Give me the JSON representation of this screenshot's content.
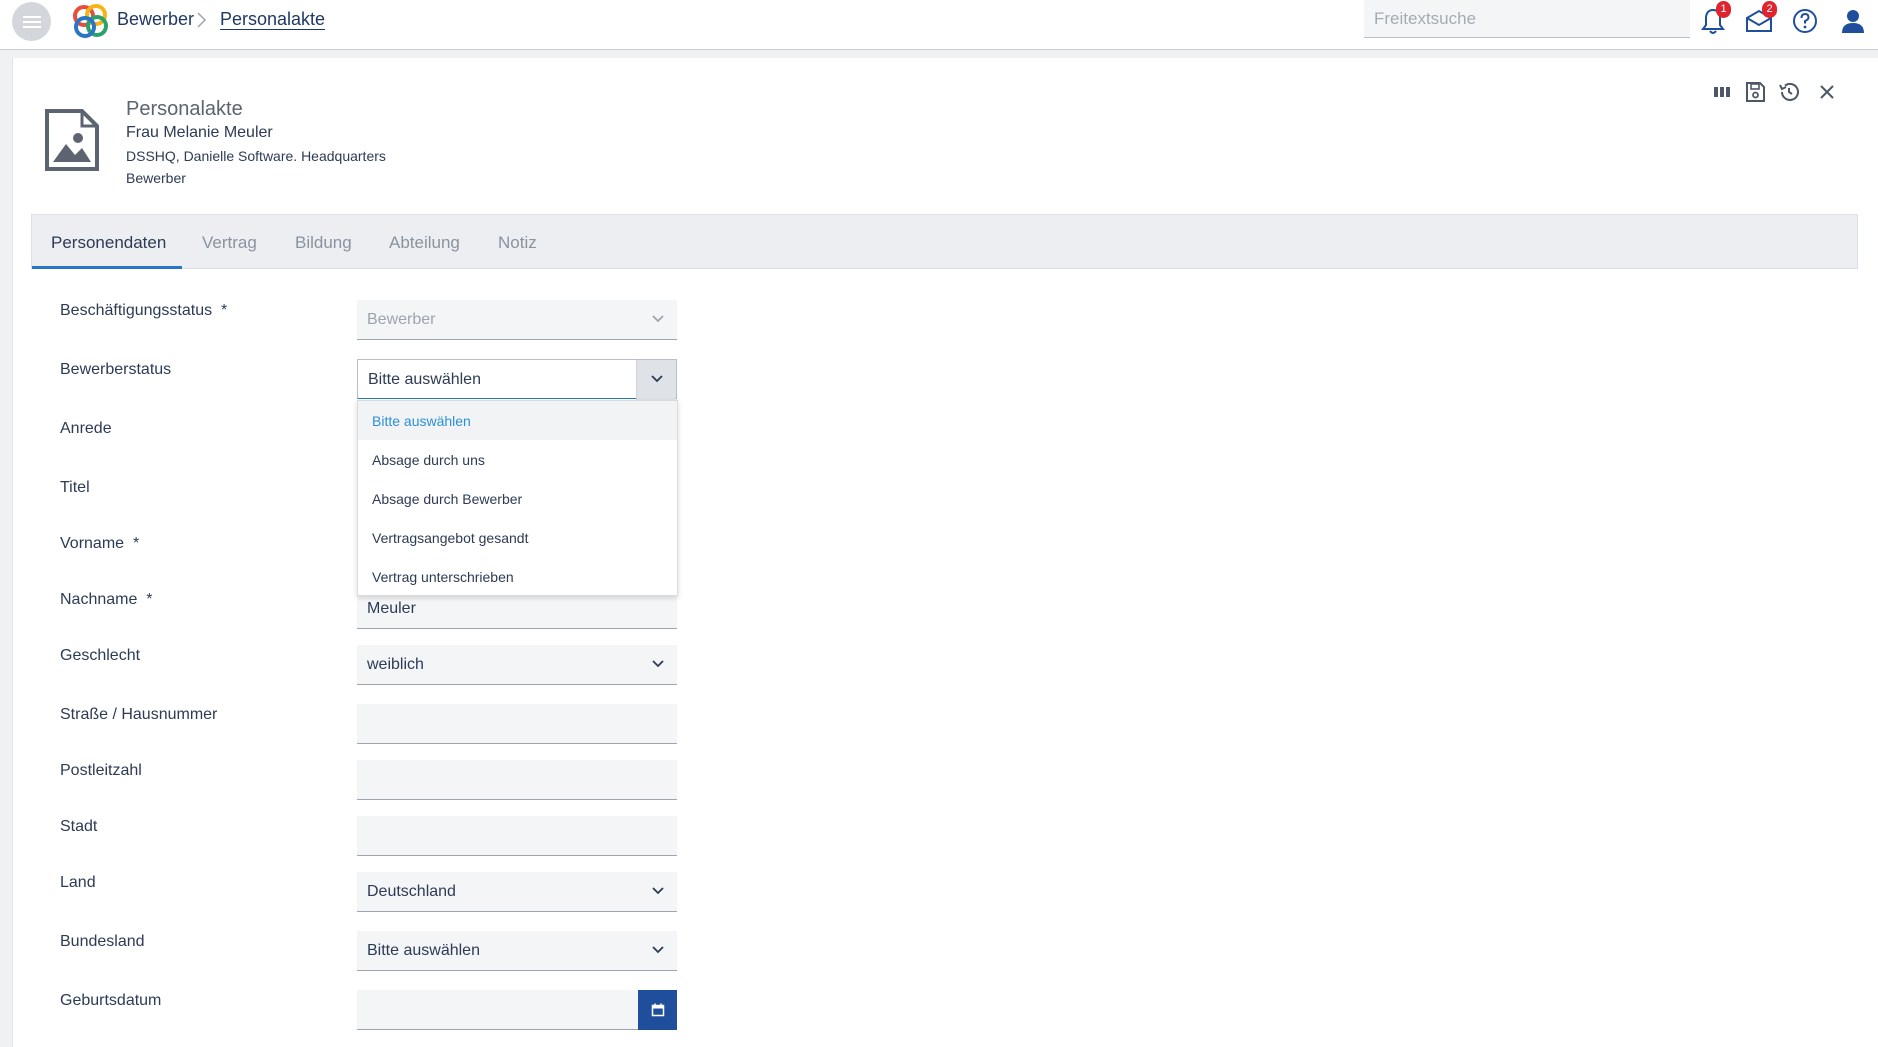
{
  "topbar": {
    "breadcrumb_root": "Bewerber",
    "breadcrumb_current": "Personalakte",
    "search_placeholder": "Freitextsuche",
    "notifications_badge": "1",
    "messages_badge": "2"
  },
  "header": {
    "title": "Personalakte",
    "name": "Frau Melanie Meuler",
    "organization": "DSSHQ, Danielle Software. Headquarters",
    "type": "Bewerber"
  },
  "tabs": [
    {
      "label": "Personendaten",
      "active": true
    },
    {
      "label": "Vertrag",
      "active": false
    },
    {
      "label": "Bildung",
      "active": false
    },
    {
      "label": "Abteilung",
      "active": false
    },
    {
      "label": "Notiz",
      "active": false
    }
  ],
  "form": {
    "beschaeftigungsstatus": {
      "label": "Beschäftigungsstatus",
      "required": "*",
      "value": "Bewerber"
    },
    "bewerberstatus": {
      "label": "Bewerberstatus",
      "value": "Bitte auswählen",
      "options": [
        "Bitte auswählen",
        "Absage durch uns",
        "Absage durch Bewerber",
        "Vertragsangebot gesandt",
        "Vertrag unterschrieben"
      ]
    },
    "anrede": {
      "label": "Anrede"
    },
    "titel": {
      "label": "Titel"
    },
    "vorname": {
      "label": "Vorname",
      "required": "*"
    },
    "nachname": {
      "label": "Nachname",
      "required": "*",
      "value": "Meuler"
    },
    "geschlecht": {
      "label": "Geschlecht",
      "value": "weiblich"
    },
    "strasse": {
      "label": "Straße / Hausnummer",
      "value": ""
    },
    "plz": {
      "label": "Postleitzahl",
      "value": ""
    },
    "stadt": {
      "label": "Stadt",
      "value": ""
    },
    "land": {
      "label": "Land",
      "value": "Deutschland"
    },
    "bundesland": {
      "label": "Bundesland",
      "value": "Bitte auswählen"
    },
    "geburtsdatum": {
      "label": "Geburtsdatum",
      "value": ""
    }
  },
  "colors": {
    "accent": "#2b75c7",
    "primary_button": "#1f4f9c",
    "badge": "#e0242f",
    "text": "#2d3b54"
  }
}
